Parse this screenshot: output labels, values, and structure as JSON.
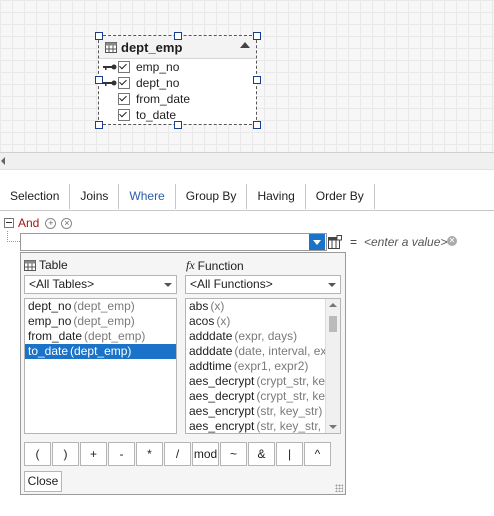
{
  "entity": {
    "name": "dept_emp",
    "fields": [
      {
        "name": "emp_no",
        "key": true,
        "checked": true
      },
      {
        "name": "dept_no",
        "key": true,
        "checked": true
      },
      {
        "name": "from_date",
        "key": false,
        "checked": true
      },
      {
        "name": "to_date",
        "key": false,
        "checked": true
      }
    ]
  },
  "tabs": [
    {
      "label": "Selection",
      "active": false
    },
    {
      "label": "Joins",
      "active": false
    },
    {
      "label": "Where",
      "active": true
    },
    {
      "label": "Group By",
      "active": false
    },
    {
      "label": "Having",
      "active": false
    },
    {
      "label": "Order By",
      "active": false
    }
  ],
  "where": {
    "operator": "And",
    "eq": "=",
    "value_placeholder": "<enter a value>"
  },
  "popup": {
    "table_header": "Table",
    "function_header": "Function",
    "function_prefix": "fx",
    "tables_combo": "<All Tables>",
    "functions_combo": "<All Functions>",
    "columns": [
      {
        "name": "dept_no",
        "table": "(dept_emp)",
        "selected": false
      },
      {
        "name": "emp_no",
        "table": "(dept_emp)",
        "selected": false
      },
      {
        "name": "from_date",
        "table": "(dept_emp)",
        "selected": false
      },
      {
        "name": "to_date",
        "table": "(dept_emp)",
        "selected": true
      }
    ],
    "functions": [
      {
        "name": "abs",
        "args": "(x)"
      },
      {
        "name": "acos",
        "args": "(x)"
      },
      {
        "name": "adddate",
        "args": "(expr, days)"
      },
      {
        "name": "adddate",
        "args": "(date, interval, expr)"
      },
      {
        "name": "addtime",
        "args": "(expr1, expr2)"
      },
      {
        "name": "aes_decrypt",
        "args": "(crypt_str, key_str)"
      },
      {
        "name": "aes_decrypt",
        "args": "(crypt_str, key_str, init)"
      },
      {
        "name": "aes_encrypt",
        "args": "(str, key_str)"
      },
      {
        "name": "aes_encrypt",
        "args": "(str, key_str, init)"
      }
    ],
    "operators": [
      "(",
      ")",
      "+",
      "-",
      "*",
      "/",
      "mod",
      "~",
      "&",
      "|",
      "^"
    ],
    "close_label": "Close"
  },
  "colors": {
    "accent": "#1a73c8",
    "and": "#a31515",
    "active_tab": "#2b5cab"
  }
}
